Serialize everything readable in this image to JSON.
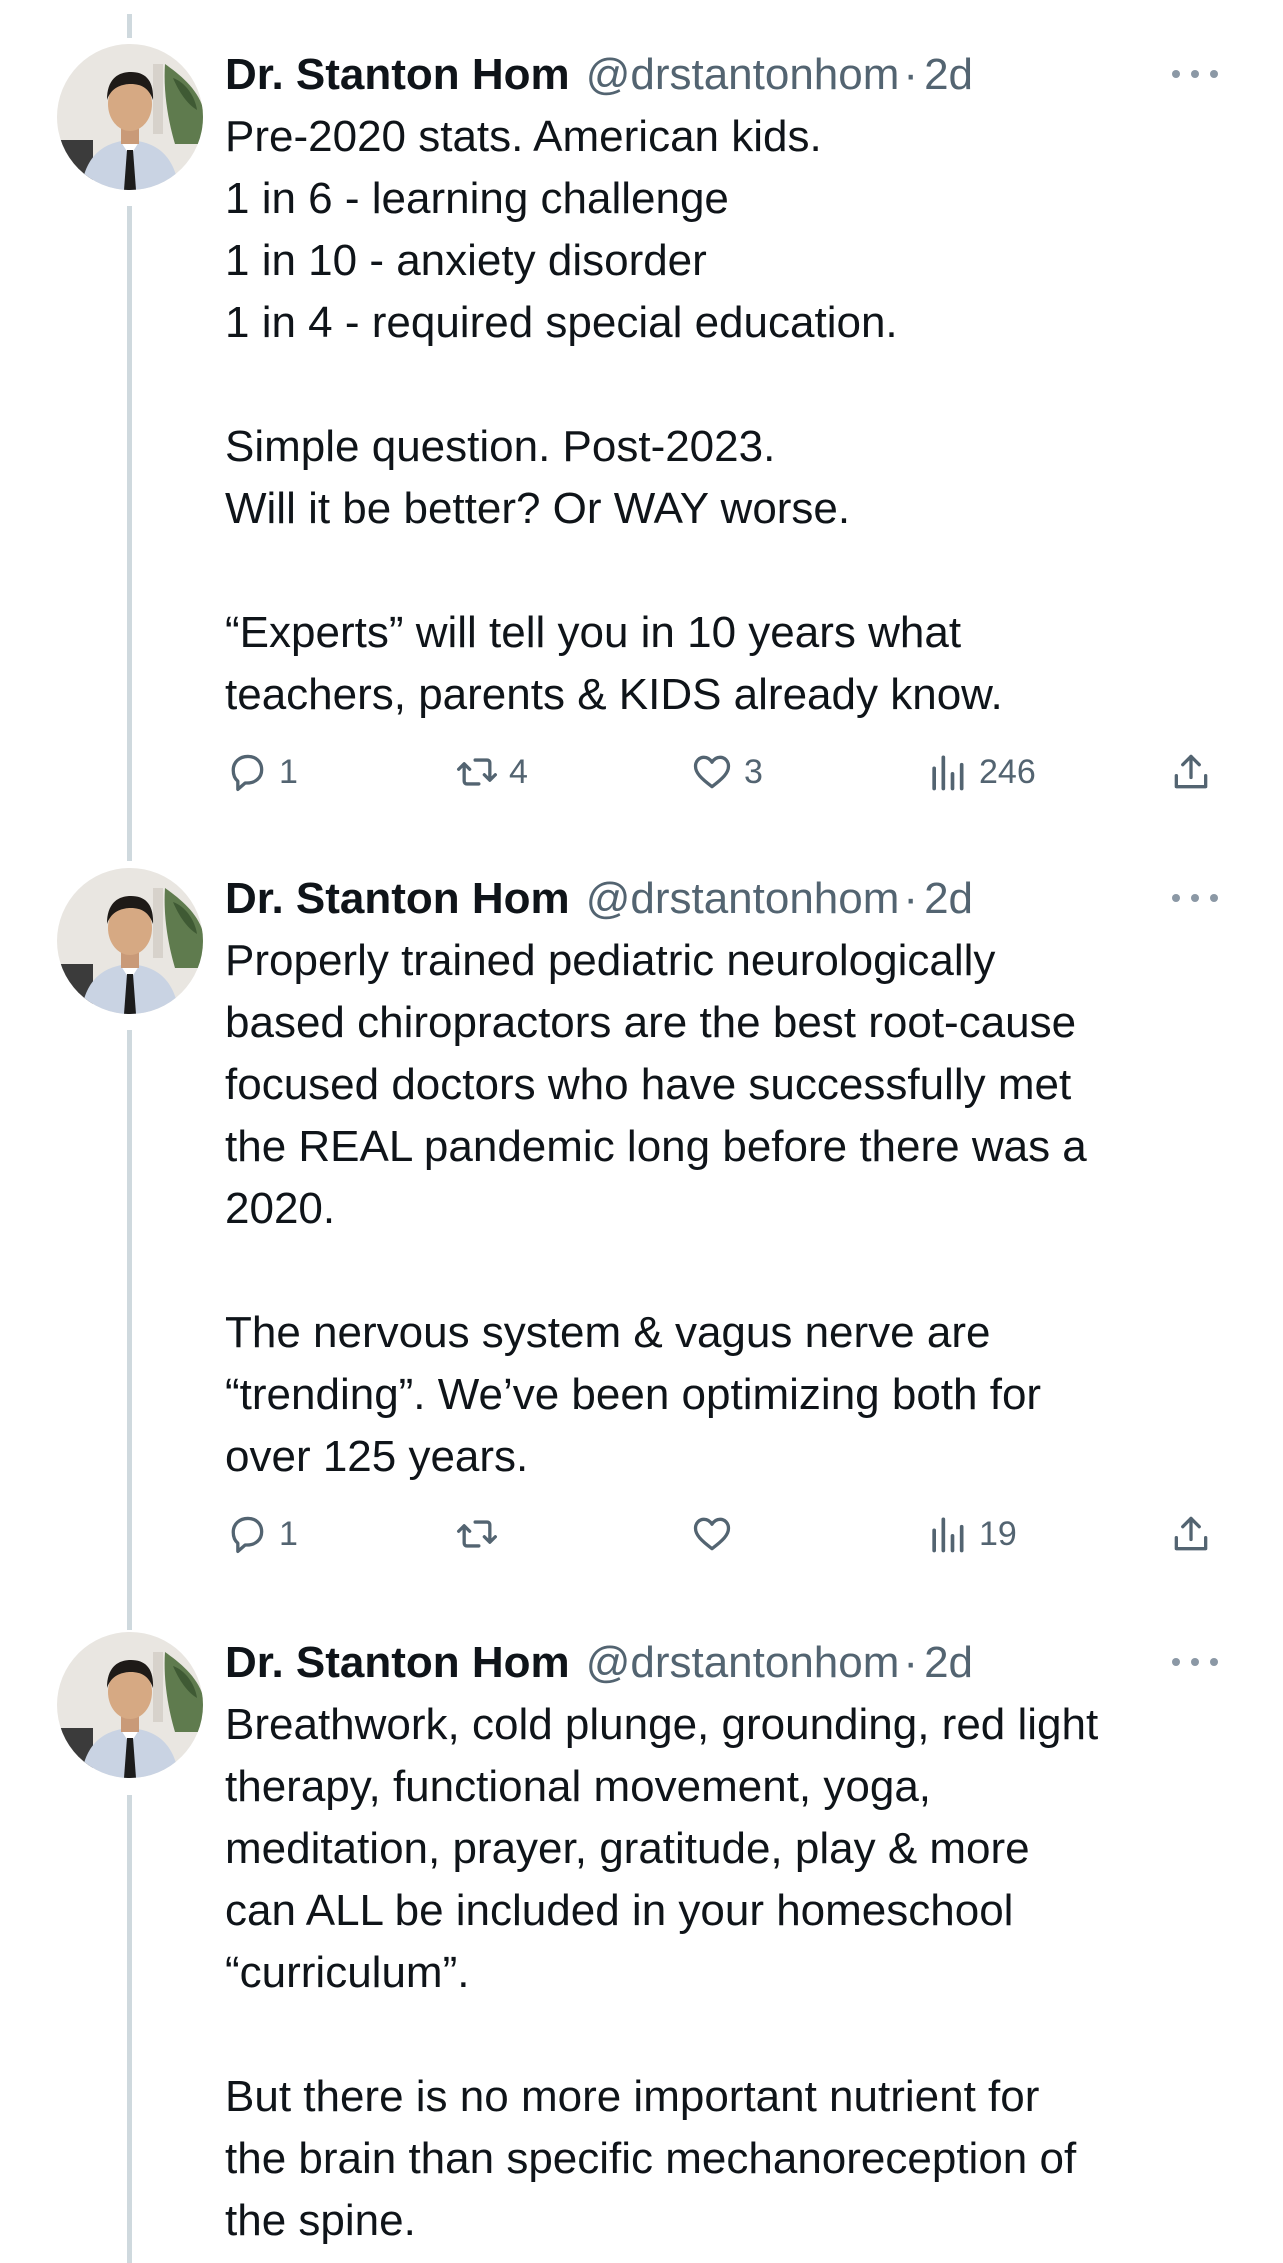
{
  "tweets": [
    {
      "author": {
        "name": "Dr. Stanton Hom",
        "handle": "@drstantonhom",
        "separator": "·",
        "time": "2d",
        "avatar": "profile-photo"
      },
      "lines": [
        "Pre-2020 stats. American kids.",
        "1 in 6 - learning challenge",
        "1 in 10 - anxiety disorder",
        "1 in 4 - required special education.",
        "",
        "Simple question. Post-2023.",
        "Will it be better? Or WAY worse.",
        "",
        "“Experts” will tell you in 10 years what",
        "teachers, parents & KIDS already know."
      ],
      "actions": {
        "replies": "1",
        "reposts": "4",
        "likes": "3",
        "views": "246"
      }
    },
    {
      "author": {
        "name": "Dr. Stanton Hom",
        "handle": "@drstantonhom",
        "separator": "·",
        "time": "2d",
        "avatar": "profile-photo"
      },
      "lines": [
        "Properly trained pediatric neurologically",
        "based chiropractors are the best root-cause",
        "focused doctors who have successfully met",
        "the REAL pandemic long before there was a",
        "2020.",
        "",
        "The nervous system & vagus nerve are",
        "“trending”. We’ve been optimizing both for",
        "over 125 years."
      ],
      "actions": {
        "replies": "1",
        "reposts": "",
        "likes": "",
        "views": "19"
      }
    },
    {
      "author": {
        "name": "Dr. Stanton Hom",
        "handle": "@drstantonhom",
        "separator": "·",
        "time": "2d",
        "avatar": "profile-photo"
      },
      "lines": [
        "Breathwork, cold plunge, grounding, red light",
        "therapy, functional movement, yoga,",
        "meditation, prayer, gratitude, play & more",
        "can ALL be included in your homeschool",
        "“curriculum”.",
        "",
        "But there is no more important nutrient for",
        "the brain than specific mechanoreception of",
        "the spine."
      ],
      "actions": null
    }
  ],
  "icons": {
    "reply": "reply-icon",
    "repost": "repost-icon",
    "like": "like-icon",
    "views": "views-icon",
    "share": "share-icon",
    "more": "more-icon"
  },
  "colors": {
    "text": "#0f1419",
    "secondary": "#536471",
    "thread_line": "#cfd9de",
    "background": "#ffffff"
  }
}
